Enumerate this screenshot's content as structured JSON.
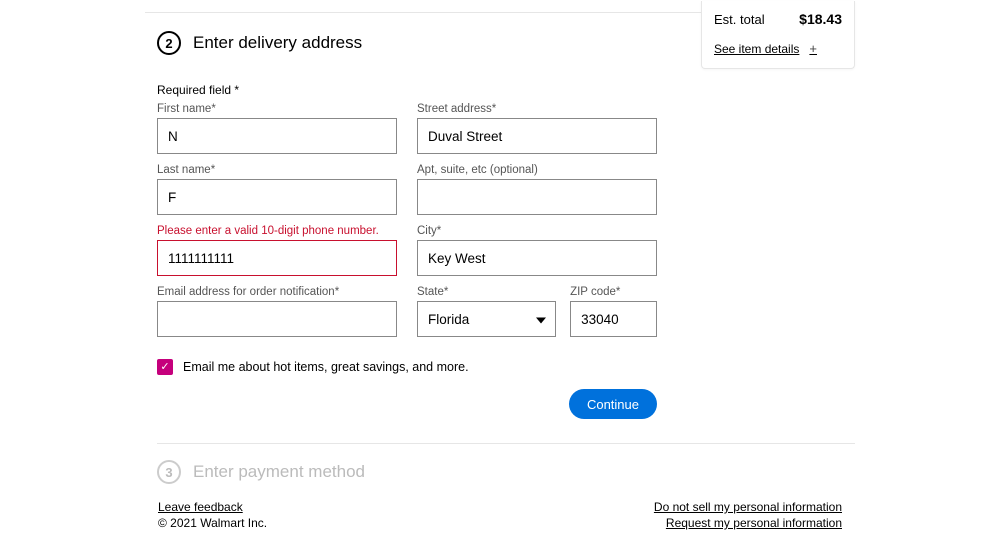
{
  "summary": {
    "est_label": "Est. total",
    "est_total": "$18.43",
    "see_details": "See item details"
  },
  "step2": {
    "number": "2",
    "title": "Enter delivery address",
    "required_note": "Required field *",
    "first_name_label": "First name*",
    "first_name_value": "N",
    "last_name_label": "Last name*",
    "last_name_value": "F",
    "phone_error": "Please enter a valid 10-digit phone number.",
    "phone_value": "1111111111",
    "email_label": "Email address for order notification*",
    "email_value": "",
    "street_label": "Street address*",
    "street_value": "Duval Street",
    "apt_label": "Apt, suite, etc (optional)",
    "apt_value": "",
    "city_label": "City*",
    "city_value": "Key West",
    "state_label": "State*",
    "state_value": "Florida",
    "zip_label": "ZIP code*",
    "zip_value": "33040",
    "opt_in_label": "Email me about hot items, great savings, and more.",
    "continue": "Continue"
  },
  "step3": {
    "number": "3",
    "title": "Enter payment method"
  },
  "footer": {
    "leave_feedback": "Leave feedback",
    "copyright": "© 2021 Walmart Inc.",
    "do_not_sell": "Do not sell my personal information",
    "request_info": "Request my personal information"
  }
}
